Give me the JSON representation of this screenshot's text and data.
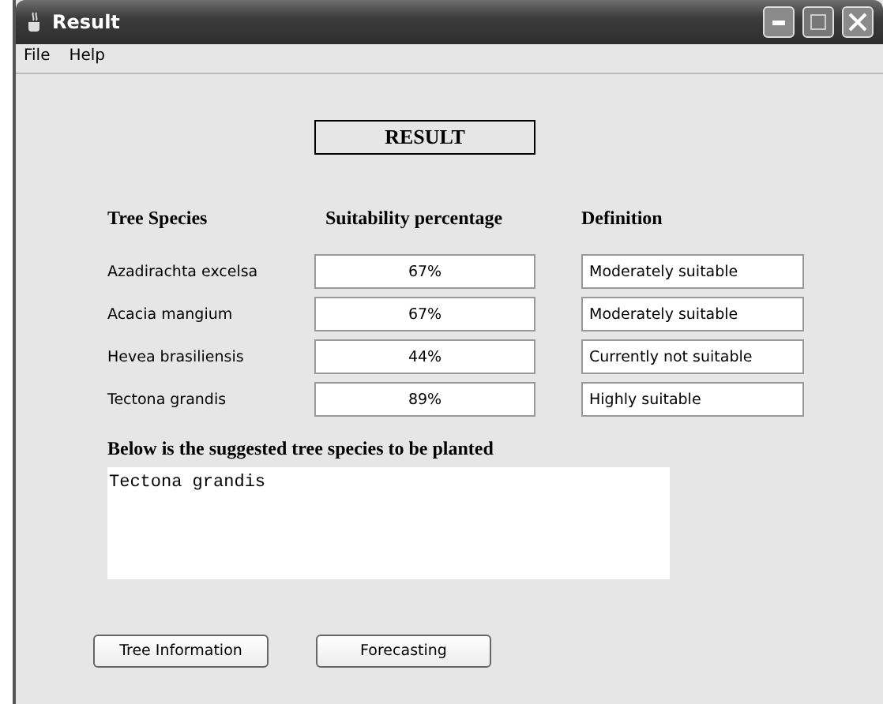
{
  "window": {
    "title": "Result"
  },
  "menu": [
    "File",
    "Help"
  ],
  "heading": "RESULT",
  "columns": [
    "Tree Species",
    "Suitability percentage",
    "Definition"
  ],
  "rows": [
    {
      "species": "Azadirachta excelsa",
      "percentage": "67%",
      "definition": "Moderately suitable"
    },
    {
      "species": "Acacia mangium",
      "percentage": "67%",
      "definition": "Moderately suitable"
    },
    {
      "species": "Hevea brasiliensis",
      "percentage": "44%",
      "definition": "Currently not suitable"
    },
    {
      "species": "Tectona grandis",
      "percentage": "89%",
      "definition": "Highly suitable"
    }
  ],
  "suggestion": {
    "label": "Below is the suggested tree species to be planted",
    "value": "Tectona grandis"
  },
  "buttons": [
    "Tree Information",
    "Forecasting"
  ]
}
